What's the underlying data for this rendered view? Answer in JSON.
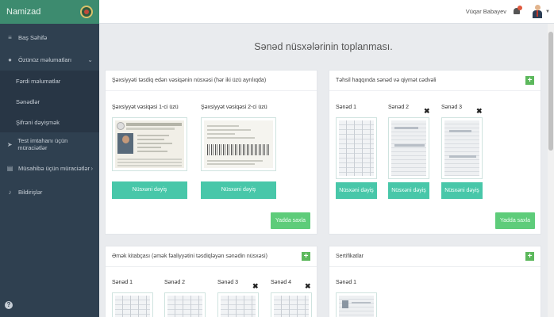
{
  "sidebar": {
    "brand": "Namizad",
    "items": [
      {
        "label": "Baş Səhifə",
        "icon": "bars-icon"
      },
      {
        "label": "Özünüz məlumatları",
        "icon": "user-icon"
      },
      {
        "label": "Test imtahanı üçün müraciətlər",
        "icon": "paper-plane-icon"
      },
      {
        "label": "Müsahibə üçün müraciətlər",
        "icon": "book-icon"
      },
      {
        "label": "Bildirişlər",
        "icon": "bell-icon"
      }
    ],
    "subitems": [
      {
        "label": "Fərdi məlumatlar"
      },
      {
        "label": "Sənədlər"
      },
      {
        "label": "Şifrəni dəyişmək"
      }
    ]
  },
  "topbar": {
    "user_name": "Vüqar Babayev"
  },
  "page_title": "Sənəd nüsxələrinin toplanması.",
  "identity_panel": {
    "title": "Şəxsiyyəti təsdiq edən vəsiqənin nüsxəsi (hər iki üzü ayrılıqda)",
    "front_label": "Şəxsiyyət vəsiqəsi 1-ci üzü",
    "back_label": "Şəxsiyyət vəsiqəsi 2-ci üzü",
    "change_label": "Nüsxəni dəyiş",
    "save_label": "Yadda saxla"
  },
  "education_panel": {
    "title": "Təhsil haqqında sənəd və qiymət cədvəli",
    "docs": [
      {
        "label": "Sənəd 1"
      },
      {
        "label": "Sənəd 2"
      },
      {
        "label": "Sənəd 3"
      }
    ],
    "change_label": "Nüsxəni dəyiş",
    "save_label": "Yadda saxla"
  },
  "labor_panel": {
    "title": "Əmək kitabçası (əmək fəaliyyətini təsdiqləyən sənədin nüsxəsi)",
    "docs": [
      {
        "label": "Sənəd 1"
      },
      {
        "label": "Sənəd 2"
      },
      {
        "label": "Sənəd 3"
      },
      {
        "label": "Sənəd 4"
      }
    ]
  },
  "certificates_panel": {
    "title": "Sertifikatlar",
    "docs": [
      {
        "label": "Sənəd 1"
      }
    ]
  },
  "id_card": {
    "country_text": "AZƏRBAYCAN RESPUBLİKASI"
  },
  "colors": {
    "sidebar": "#2f4050",
    "brand": "#3d8b6f",
    "teal": "#48c7a9",
    "green": "#5ecc7a"
  }
}
